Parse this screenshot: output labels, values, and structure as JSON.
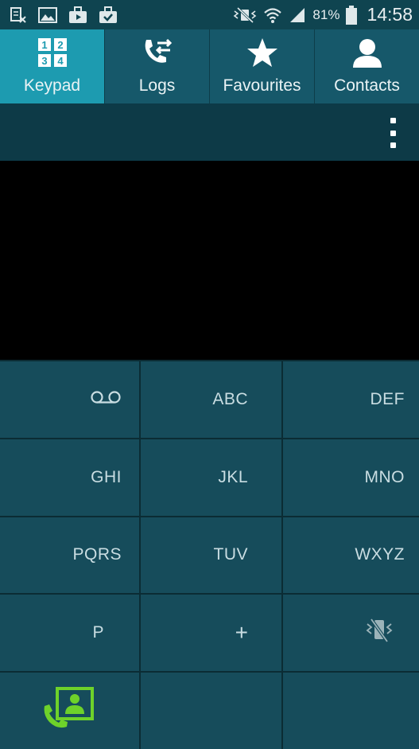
{
  "status_bar": {
    "battery_percent": "81%",
    "time": "14:58",
    "left_icons": [
      "screenshot-notification-icon",
      "gallery-icon",
      "media-bag-icon",
      "tasks-briefcase-icon"
    ],
    "right_icons": [
      "mute-vibrate-icon",
      "wifi-icon",
      "signal-icon",
      "battery-icon"
    ]
  },
  "tabs": [
    {
      "label": "Keypad",
      "icon": "keypad-icon",
      "active": true
    },
    {
      "label": "Logs",
      "icon": "call-logs-icon",
      "active": false
    },
    {
      "label": "Favourites",
      "icon": "star-icon",
      "active": false
    },
    {
      "label": "Contacts",
      "icon": "contact-person-icon",
      "active": false
    }
  ],
  "keypad": {
    "row1": [
      "",
      "ABC",
      "DEF"
    ],
    "row2": [
      "GHI",
      "JKL",
      "MNO"
    ],
    "row3": [
      "PQRS",
      "TUV",
      "WXYZ"
    ],
    "row4": [
      "P",
      "+",
      ""
    ]
  },
  "colors": {
    "status_bar": "#0f4450",
    "tab_bar": "#16586a",
    "active_tab": "#1d9bb0",
    "action_bar": "#0d3a47",
    "key_bg": "#164c5b",
    "call_green": "#6ed22a"
  }
}
